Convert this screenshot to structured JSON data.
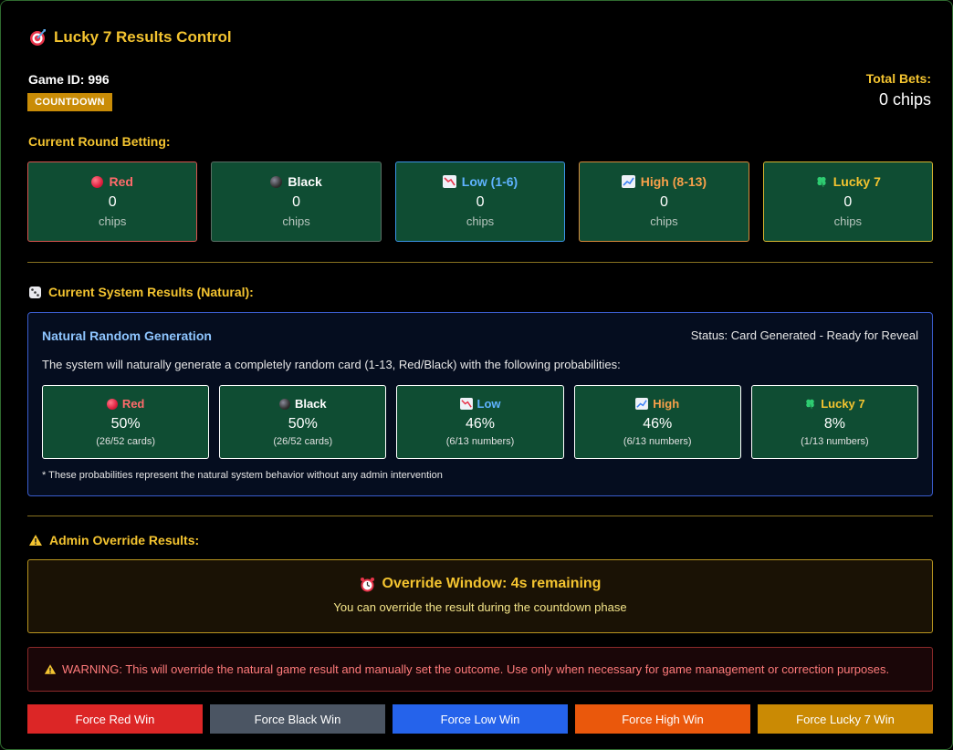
{
  "header": {
    "title": "Lucky 7 Results Control",
    "icon": "target-icon"
  },
  "game": {
    "id_label": "Game ID: 996",
    "status_badge": "COUNTDOWN",
    "total_bets_label": "Total Bets:",
    "total_bets_value": "0 chips"
  },
  "betting": {
    "title": "Current Round Betting:",
    "cards": [
      {
        "label": "Red",
        "amount": "0",
        "unit": "chips"
      },
      {
        "label": "Black",
        "amount": "0",
        "unit": "chips"
      },
      {
        "label": "Low (1-6)",
        "amount": "0",
        "unit": "chips"
      },
      {
        "label": "High (8-13)",
        "amount": "0",
        "unit": "chips"
      },
      {
        "label": "Lucky 7",
        "amount": "0",
        "unit": "chips"
      }
    ]
  },
  "natural": {
    "section_title": "Current System Results (Natural):",
    "header": "Natural Random Generation",
    "status": "Status: Card Generated - Ready for Reveal",
    "description": "The system will naturally generate a completely random card (1-13, Red/Black) with the following probabilities:",
    "probabilities": [
      {
        "label": "Red",
        "percent": "50%",
        "detail": "(26/52 cards)"
      },
      {
        "label": "Black",
        "percent": "50%",
        "detail": "(26/52 cards)"
      },
      {
        "label": "Low",
        "percent": "46%",
        "detail": "(6/13 numbers)"
      },
      {
        "label": "High",
        "percent": "46%",
        "detail": "(6/13 numbers)"
      },
      {
        "label": "Lucky 7",
        "percent": "8%",
        "detail": "(1/13 numbers)"
      }
    ],
    "note": "* These probabilities represent the natural system behavior without any admin intervention"
  },
  "override": {
    "section_title": "Admin Override Results:",
    "window_title": "Override Window: 4s remaining",
    "window_subtitle": "You can override the result during the countdown phase",
    "warning": "WARNING: This will override the natural game result and manually set the outcome. Use only when necessary for game management or correction purposes.",
    "buttons": {
      "red": "Force Red Win",
      "black": "Force Black Win",
      "low": "Force Low Win",
      "high": "Force High Win",
      "lucky": "Force Lucky 7 Win"
    }
  },
  "colors": {
    "accent": "#f4c430",
    "card_bg": "#0f4d33",
    "red_button": "#dc2626",
    "black_button": "#4b5563",
    "low_button": "#2563eb",
    "high_button": "#ea580c",
    "lucky_button": "#ca8a04"
  }
}
